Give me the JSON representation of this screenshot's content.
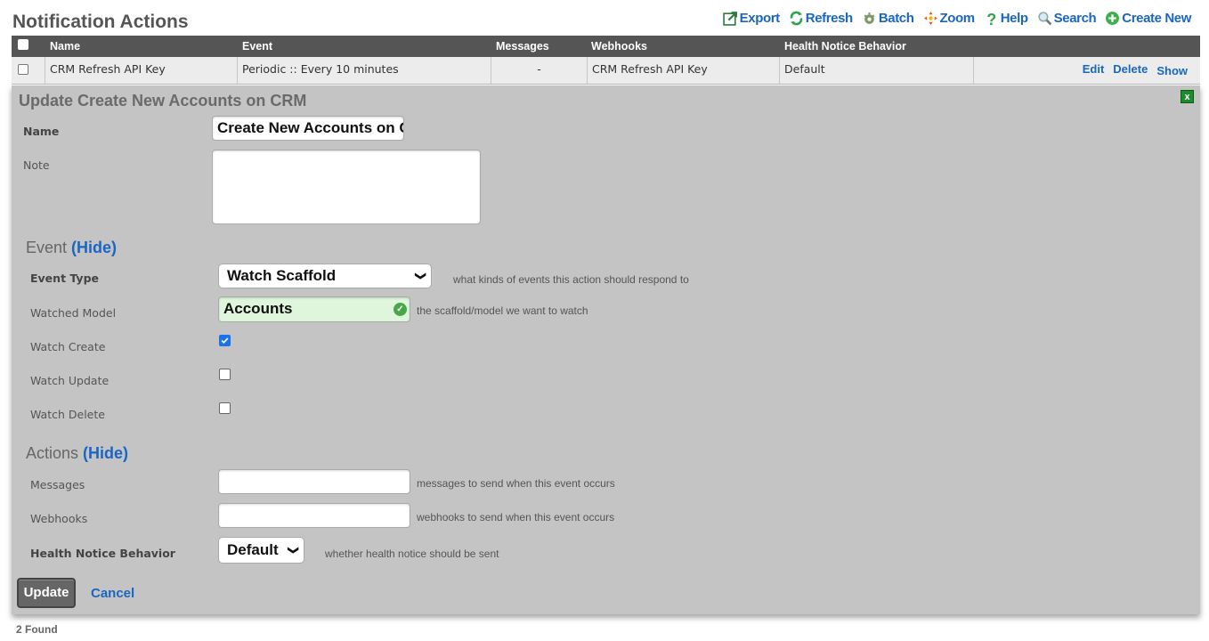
{
  "page_title": "Notification Actions",
  "toolbar": {
    "export": "Export",
    "refresh": "Refresh",
    "batch": "Batch",
    "zoom": "Zoom",
    "help": "Help",
    "search": "Search",
    "create_new": "Create New"
  },
  "table": {
    "columns": [
      "Name",
      "Event",
      "Messages",
      "Webhooks",
      "Health Notice Behavior"
    ],
    "rows": [
      {
        "name": "CRM Refresh API Key",
        "event": "Periodic :: Every 10 minutes",
        "messages": "-",
        "webhooks": "CRM Refresh API Key",
        "health": "Default",
        "actions": [
          "Edit",
          "Delete",
          "Show"
        ]
      }
    ]
  },
  "form": {
    "title": "Update Create New Accounts on CRM",
    "close": "x",
    "name_label": "Name",
    "name_value": "Create New Accounts on CRM",
    "note_label": "Note",
    "note_value": "",
    "event_section": "Event",
    "event_toggle": "(Hide)",
    "event_type_label": "Event Type",
    "event_type_value": "Watch Scaffold",
    "event_type_hint": "what kinds of events this action should respond to",
    "watched_model_label": "Watched Model",
    "watched_model_value": "Accounts",
    "watched_model_hint": "the scaffold/model we want to watch",
    "watch_create_label": "Watch Create",
    "watch_create_checked": true,
    "watch_update_label": "Watch Update",
    "watch_update_checked": false,
    "watch_delete_label": "Watch Delete",
    "watch_delete_checked": false,
    "actions_section": "Actions",
    "actions_toggle": "(Hide)",
    "messages_label": "Messages",
    "messages_value": "",
    "messages_hint": "messages to send when this event occurs",
    "webhooks_label": "Webhooks",
    "webhooks_value": "",
    "webhooks_hint": "webhooks to send when this event occurs",
    "health_label": "Health Notice Behavior",
    "health_value": "Default",
    "health_hint": "whether health notice should be sent",
    "update_button": "Update",
    "cancel_button": "Cancel"
  },
  "footer": {
    "found": "2 Found"
  },
  "colors": {
    "link": "#1a66c2",
    "header_bg": "#555555",
    "panel_bg": "#c4c4c4",
    "valid_bg": "#dff5dc"
  }
}
